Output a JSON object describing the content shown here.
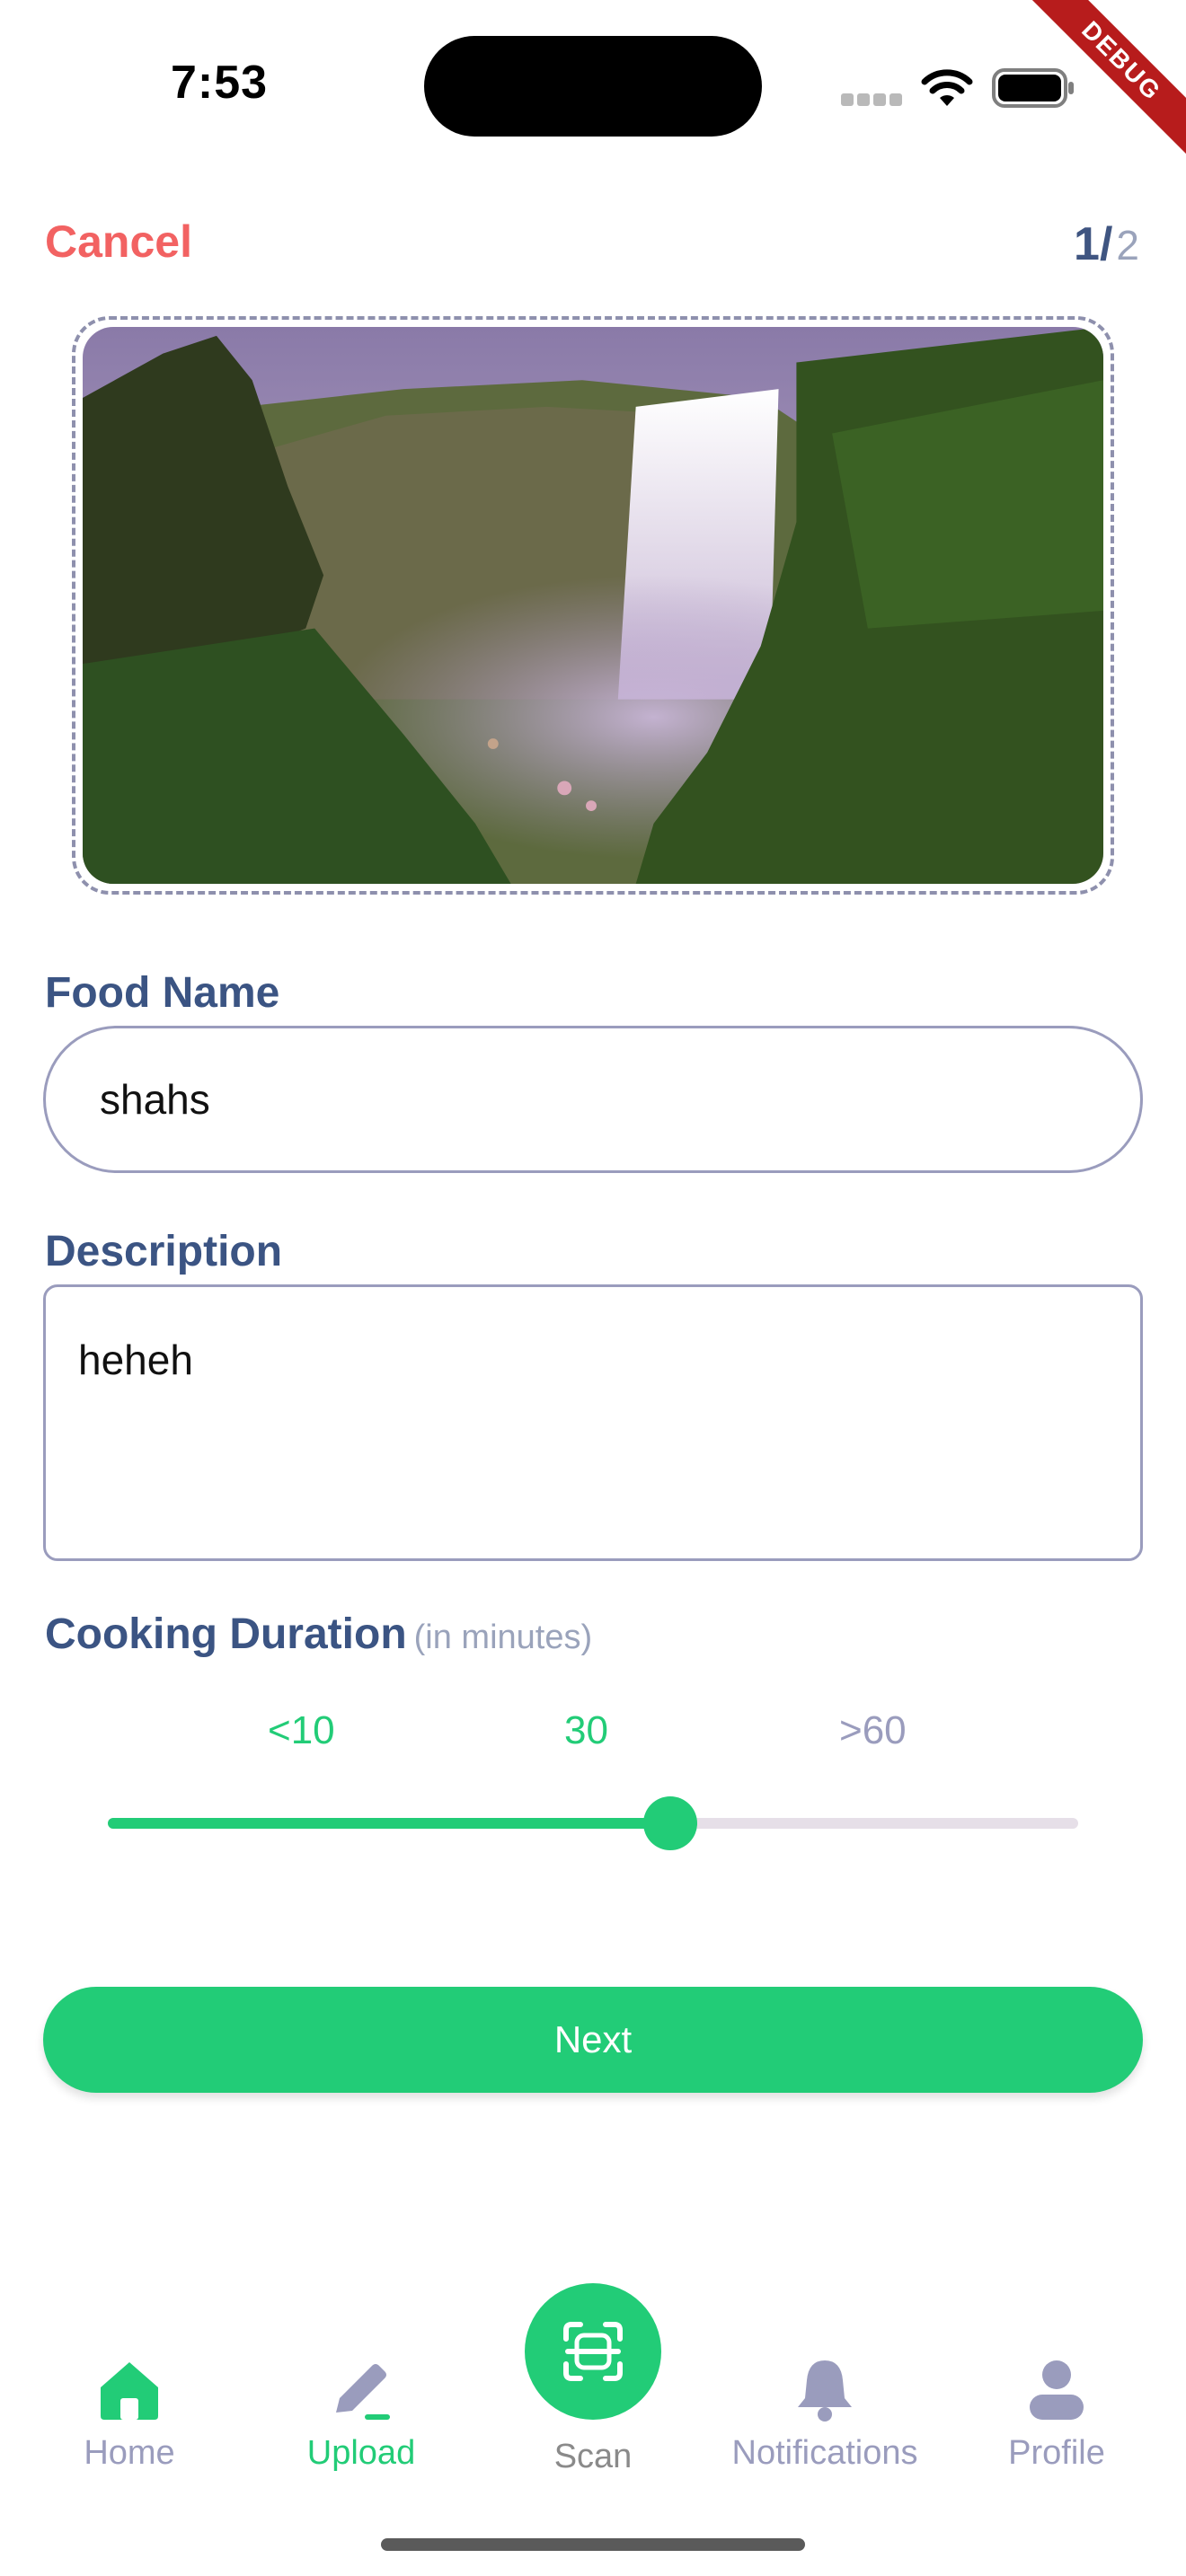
{
  "status_bar": {
    "time": "7:53",
    "debug_label": "DEBUG"
  },
  "header": {
    "cancel_label": "Cancel",
    "step_current": "1/",
    "step_total": "2"
  },
  "form": {
    "food_name_label": "Food Name",
    "food_name_value": "shahs",
    "description_label": "Description",
    "description_value": "heheh",
    "duration_label": "Cooking Duration",
    "duration_hint": "(in minutes)"
  },
  "slider": {
    "ticks": [
      "<10",
      "30",
      ">60"
    ],
    "active_color": "#22cc77",
    "inactive_color": "#e6dfe8",
    "fraction": 0.58
  },
  "next_button_label": "Next",
  "bottom_nav": {
    "items": [
      {
        "label": "Home",
        "icon": "home-icon",
        "active": true
      },
      {
        "label": "Upload",
        "icon": "pencil-icon",
        "active": true
      },
      {
        "label": "Scan",
        "icon": "scan-icon",
        "active": false
      },
      {
        "label": "Notifications",
        "icon": "bell-icon",
        "active": false
      },
      {
        "label": "Profile",
        "icon": "person-icon",
        "active": false
      }
    ]
  },
  "colors": {
    "accent": "#22cc77",
    "cancel": "#f26262",
    "label": "#3b5483",
    "muted": "#9a9cbd"
  }
}
